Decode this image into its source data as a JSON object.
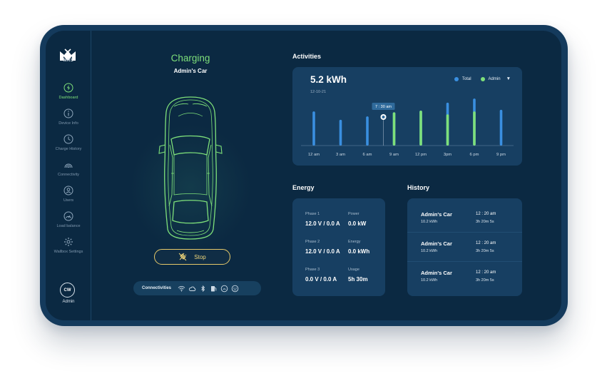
{
  "brand": {
    "logo_text": "MRS"
  },
  "sidebar": {
    "items": [
      {
        "label": "Dashboard",
        "icon": "bolt-icon",
        "active": true
      },
      {
        "label": "Device Info",
        "icon": "info-icon"
      },
      {
        "label": "Charge History",
        "icon": "clock-icon"
      },
      {
        "label": "Connectivity",
        "icon": "signal-icon"
      },
      {
        "label": "Users",
        "icon": "user-icon"
      },
      {
        "label": "Load balance",
        "icon": "gauge-icon"
      },
      {
        "label": "Wallbox Settings",
        "icon": "gear-icon"
      }
    ],
    "user": {
      "initials": "CW",
      "name": "Admin"
    }
  },
  "status": {
    "title": "Charging",
    "car_name": "Admin's Car"
  },
  "actions": {
    "stop_label": "Stop"
  },
  "connectivities": {
    "label": "Connectivities",
    "icons": [
      "wifi-icon",
      "cloud-icon",
      "bluetooth-icon",
      "fuel-station-icon",
      "rfid-icon",
      "network-icon"
    ]
  },
  "activities": {
    "title": "Activities",
    "value": "5.2 kWh",
    "date": "12-10-21",
    "legend": [
      {
        "name": "Total",
        "color": "#3a8fe0"
      },
      {
        "name": "Admin",
        "color": "#7ee07a"
      }
    ],
    "tooltip": "7 : 30 am"
  },
  "chart_data": {
    "type": "bar",
    "categories": [
      "12 am",
      "3 am",
      "6 am",
      "9 am",
      "12 pm",
      "3pm",
      "6 pm",
      "9 pm"
    ],
    "series": [
      {
        "name": "Total",
        "values": [
          0.82,
          0.62,
          0.7,
          0.8,
          0.84,
          1.03,
          1.13,
          0.86
        ]
      },
      {
        "name": "Admin",
        "values": [
          0,
          0,
          0,
          0.8,
          0.84,
          0.75,
          0.82,
          0
        ]
      }
    ],
    "ylim": [
      0,
      1.2
    ],
    "colors": {
      "Total": "#3a8fe0",
      "Admin": "#7ee07a"
    },
    "highlight": {
      "x": "7:30 am",
      "label": "7 : 30 am"
    },
    "grid": false
  },
  "energy": {
    "title": "Energy",
    "rows": [
      {
        "phase_label": "Phase 1",
        "phase_value": "12.0 V / 0.0 A",
        "metric_label": "Power",
        "metric_value": "0.0 kW"
      },
      {
        "phase_label": "Phase 2",
        "phase_value": "12.0 V / 0.0 A",
        "metric_label": "Energy",
        "metric_value": "0.0 kWh"
      },
      {
        "phase_label": "Phase 3",
        "phase_value": "0.0 V / 0.0 A",
        "metric_label": "Usage",
        "metric_value": "5h 30m"
      }
    ]
  },
  "history": {
    "title": "History",
    "items": [
      {
        "name": "Admin's Car",
        "energy": "10.2 kWh",
        "time": "12 : 20 am",
        "duration": "3h 20m 5s"
      },
      {
        "name": "Admin's Car",
        "energy": "10.2 kWh",
        "time": "12 : 20 am",
        "duration": "3h 20m 5s"
      },
      {
        "name": "Admin's Car",
        "energy": "10.2 kWh",
        "time": "12 : 20 am",
        "duration": "3h 20m 5s"
      }
    ]
  }
}
